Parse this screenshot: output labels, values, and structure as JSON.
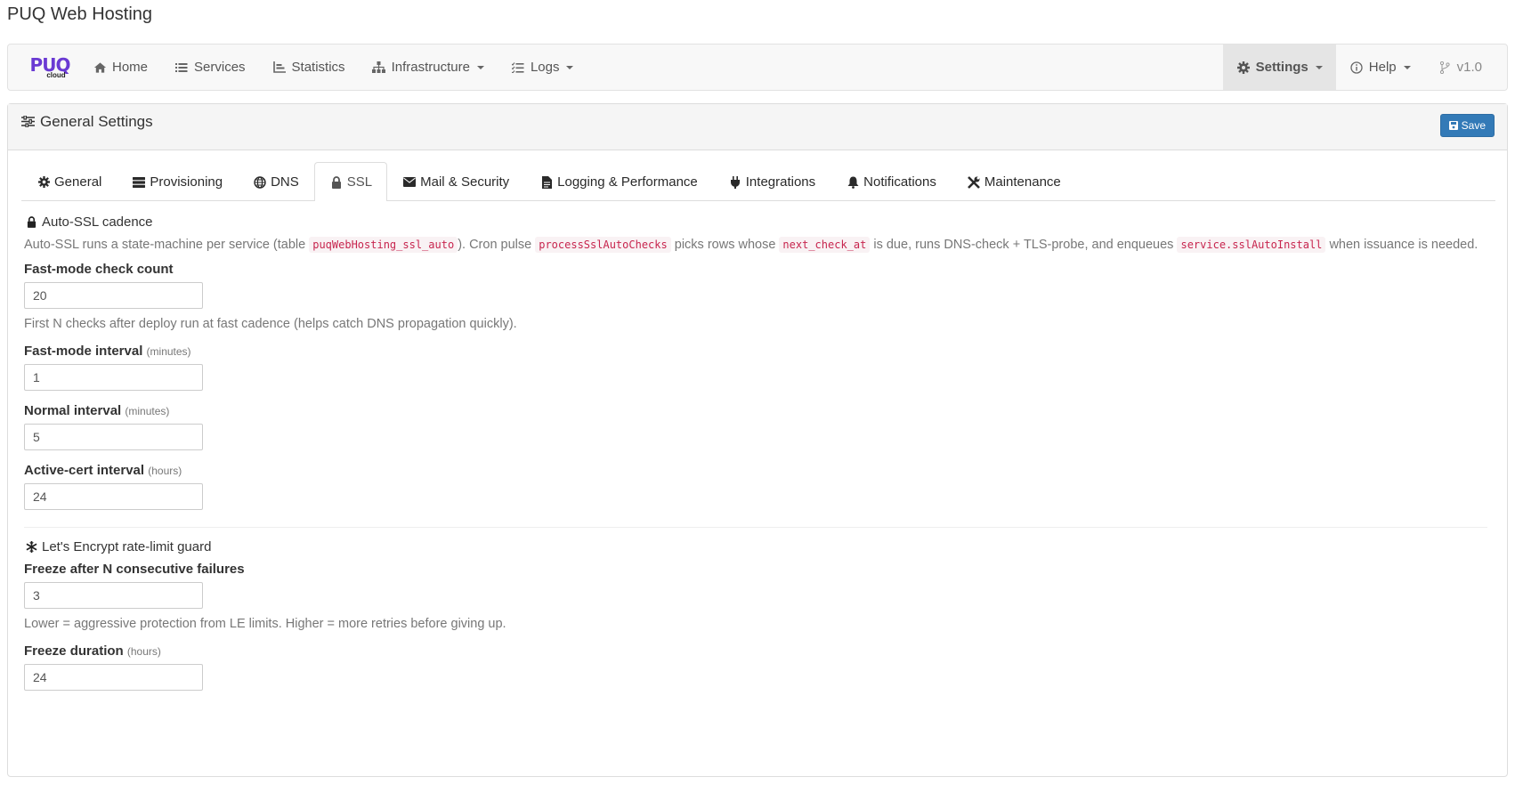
{
  "app": {
    "title": "PUQ Web Hosting"
  },
  "brand": {
    "name": "PUQ",
    "sub": "cloud",
    "color": "#6a3ad3"
  },
  "nav": {
    "left": [
      {
        "label": "Home",
        "icon": "home-icon"
      },
      {
        "label": "Services",
        "icon": "list-icon"
      },
      {
        "label": "Statistics",
        "icon": "chart-icon"
      },
      {
        "label": "Infrastructure",
        "icon": "sitemap-icon",
        "dropdown": true
      },
      {
        "label": "Logs",
        "icon": "tasks-icon",
        "dropdown": true
      }
    ],
    "right": [
      {
        "label": "Settings",
        "icon": "gear-icon",
        "dropdown": true,
        "active": true
      },
      {
        "label": "Help",
        "icon": "info-icon",
        "dropdown": true
      },
      {
        "label": "v1.0",
        "icon": "branch-icon"
      }
    ]
  },
  "panel": {
    "title": "General Settings",
    "save_label": "Save"
  },
  "tabs": [
    {
      "label": "General",
      "icon": "gear-icon"
    },
    {
      "label": "Provisioning",
      "icon": "server-icon"
    },
    {
      "label": "DNS",
      "icon": "globe-icon"
    },
    {
      "label": "SSL",
      "icon": "lock-icon",
      "active": true
    },
    {
      "label": "Mail & Security",
      "icon": "envelope-icon"
    },
    {
      "label": "Logging & Performance",
      "icon": "file-icon"
    },
    {
      "label": "Integrations",
      "icon": "plug-icon"
    },
    {
      "label": "Notifications",
      "icon": "bell-icon"
    },
    {
      "label": "Maintenance",
      "icon": "wrench-icon"
    }
  ],
  "auto_ssl": {
    "title": "Auto-SSL cadence",
    "desc_parts": {
      "t1": "Auto-SSL runs a state-machine per service (table ",
      "c1": "puqWebHosting_ssl_auto",
      "t2": "). Cron pulse ",
      "c2": "processSslAutoChecks",
      "t3": " picks rows whose ",
      "c3": "next_check_at",
      "t4": " is due, runs DNS-check + TLS-probe, and enqueues ",
      "c4": "service.sslAutoInstall",
      "t5": " when issuance is needed."
    },
    "fast_count": {
      "label": "Fast-mode check count",
      "value": "20",
      "help": "First N checks after deploy run at fast cadence (helps catch DNS propagation quickly)."
    },
    "fast_interval": {
      "label": "Fast-mode interval",
      "unit": "(minutes)",
      "value": "1"
    },
    "normal_interval": {
      "label": "Normal interval",
      "unit": "(minutes)",
      "value": "5"
    },
    "active_interval": {
      "label": "Active-cert interval",
      "unit": "(hours)",
      "value": "24"
    }
  },
  "le_guard": {
    "title": "Let's Encrypt rate-limit guard",
    "freeze_after": {
      "label": "Freeze after N consecutive failures",
      "value": "3",
      "help": "Lower = aggressive protection from LE limits. Higher = more retries before giving up."
    },
    "freeze_duration": {
      "label": "Freeze duration",
      "unit": "(hours)",
      "value": "24"
    }
  }
}
